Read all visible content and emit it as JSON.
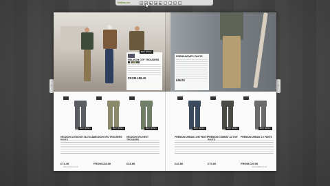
{
  "toolbar": {
    "logo": "Helikon-tex",
    "buttons": [
      "⊞",
      "⊡",
      "▶",
      "◀",
      "▶",
      "⤢",
      "⇩",
      "✉",
      "⎙"
    ]
  },
  "nav": {
    "prev": "‹",
    "next": "›"
  },
  "left_card": {
    "title": "HELIKON OTP TROUSERS",
    "price": "FROM £88.40",
    "buy": "BUY NOW ›"
  },
  "right_card": {
    "title": "PREMIUM MFC PANTS",
    "price": "£66.50"
  },
  "products": [
    {
      "name": "HELIKON OUTDOOR TACTICAL PANTS",
      "price": "£74.40"
    },
    {
      "name": "HELIKON SFU TROUSERS",
      "price": "FROM £38.90"
    },
    {
      "name": "HELIKON SFU NEXT TROUSERS",
      "price": "£33.80"
    },
    {
      "name": "PREMIUM URBAN LINE PANTS",
      "price": "£42.80"
    },
    {
      "name": "PREMIUM COMBAT ACTIVE PANTS",
      "price": "£70.00"
    },
    {
      "name": "PREMIUM URBAN 1.0 PANTS",
      "price": "FROM £20.90"
    }
  ],
  "buy_label": "BUY NOW ›",
  "footer": {
    "left": "www.helikon.co.uk",
    "right": "www.helikon.co.uk",
    "page_left": "12",
    "page_right": "13"
  },
  "colors": {
    "ot": "#5a5d61",
    "sfu_camo": "#8a8a6a",
    "sfu_next": "#6f7f68",
    "urban": "#3b4a5c",
    "combat": "#4a4a44",
    "urban10": "#6b6b6b"
  }
}
